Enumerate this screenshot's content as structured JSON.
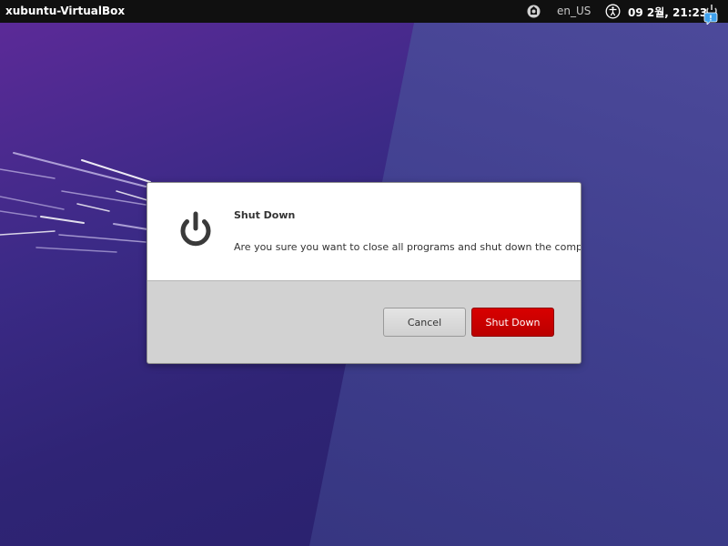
{
  "top_panel": {
    "hostname": "xubuntu-VirtualBox",
    "keyboard_layout": "en_US",
    "clock": "09 2월, 21:23",
    "icons": [
      "update-notifier-icon",
      "accessibility-icon",
      "power-icon"
    ]
  },
  "dialog": {
    "title": "Shut Down",
    "message": "Are you sure you want to close all programs and shut down the computer?",
    "cancel_label": "Cancel",
    "shutdown_label": "Shut Down",
    "icon": "power-icon"
  },
  "colors": {
    "panel_bg": "#101010",
    "shutdown_button": "#cc0000",
    "dialog_footer": "#d2d2d2",
    "wallpaper_primary": "#3b2a86"
  }
}
